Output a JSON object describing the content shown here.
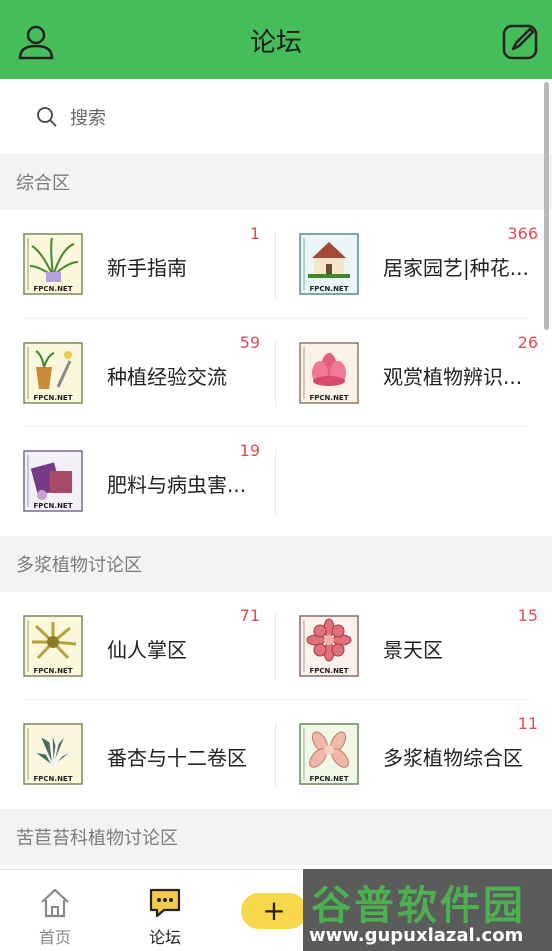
{
  "header": {
    "title": "论坛"
  },
  "search": {
    "placeholder": "搜索"
  },
  "sections": [
    {
      "title": "综合区",
      "items": [
        {
          "name": "新手指南",
          "count": "1",
          "thumb": "spider-plant"
        },
        {
          "name": "居家园艺|种花...",
          "count": "366",
          "thumb": "house"
        },
        {
          "name": "种植经验交流",
          "count": "59",
          "thumb": "pot-tools"
        },
        {
          "name": "观赏植物辨识...",
          "count": "26",
          "thumb": "lotus"
        },
        {
          "name": "肥料与病虫害...",
          "count": "19",
          "thumb": "fertilizer"
        }
      ]
    },
    {
      "title": "多浆植物讨论区",
      "items": [
        {
          "name": "仙人掌区",
          "count": "71",
          "thumb": "cactus"
        },
        {
          "name": "景天区",
          "count": "15",
          "thumb": "echeveria"
        },
        {
          "name": "番杏与十二卷区",
          "count": "",
          "thumb": "haworthia"
        },
        {
          "name": "多浆植物综合区",
          "count": "11",
          "thumb": "succulent"
        }
      ]
    },
    {
      "title": "苦苣苔科植物讨论区",
      "items": []
    }
  ],
  "thumb_caption": "FPCN.NET",
  "tabbar": {
    "home_label": "首页",
    "forum_label": "论坛",
    "add_label": "+"
  },
  "watermark": {
    "title": "谷普软件园",
    "url": "www.gupuxlazal.com"
  },
  "colors": {
    "accent": "#45bd5a",
    "count": "#e64a56",
    "add": "#f7d84c"
  }
}
